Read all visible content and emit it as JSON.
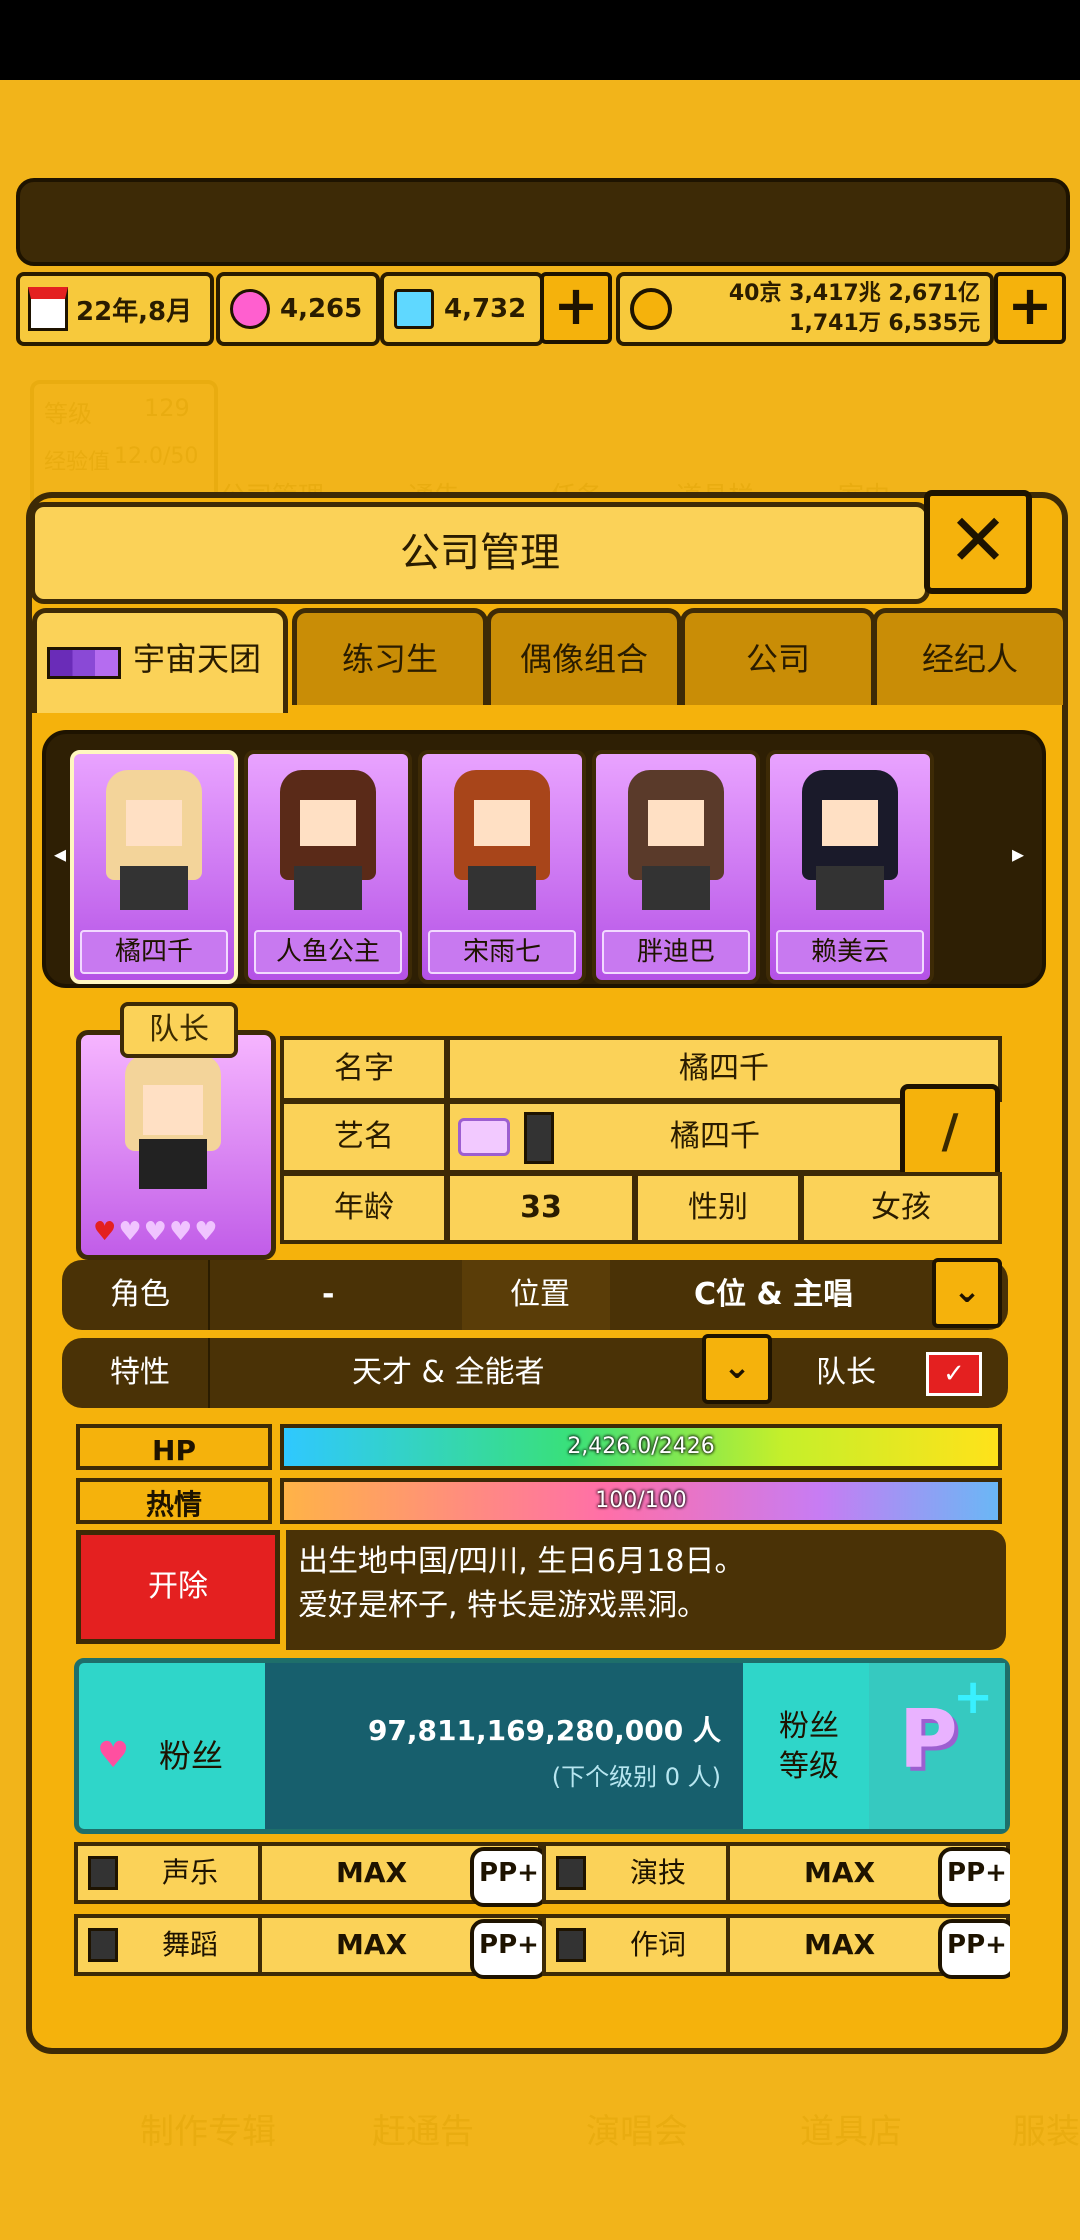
{
  "resources": {
    "date": "22年,8月",
    "gems_pink": "4,265",
    "gems_blue": "4,732",
    "money_line1": "40京 3,417兆 2,671亿",
    "money_line2": "1,741万 6,535元"
  },
  "background_menu": {
    "level_label": "等级",
    "level_value": "129",
    "exp_label": "经验值",
    "exp_value": "12.0/50",
    "top_items": [
      "公司管理",
      "通告",
      "任务",
      "道具栏",
      "室内"
    ],
    "bottom_items": [
      "制作专辑",
      "赶通告",
      "演唱会",
      "道具店",
      "服装"
    ]
  },
  "dialog": {
    "title": "公司管理",
    "close_icon": "close-x-icon",
    "tabs": [
      "宇宙天团",
      "练习生",
      "偶像组合",
      "公司",
      "经纪人"
    ],
    "active_tab": 0
  },
  "roster": [
    {
      "name": "橘四千",
      "selected": true
    },
    {
      "name": "人鱼公主",
      "selected": false
    },
    {
      "name": "宋雨七",
      "selected": false
    },
    {
      "name": "胖迪巴",
      "selected": false
    },
    {
      "name": "赖美云",
      "selected": false
    }
  ],
  "profile": {
    "leader_badge": "队长",
    "hearts_filled": 1,
    "hearts_total": 5,
    "name_label": "名字",
    "name_value": "橘四千",
    "stage_label": "艺名",
    "stage_value": "橘四千",
    "age_label": "年龄",
    "age_value": "33",
    "gender_label": "性别",
    "gender_value": "女孩",
    "role_label": "角色",
    "role_value": "-",
    "position_label": "位置",
    "position_value": "C位 & 主唱",
    "trait_label": "特性",
    "trait_value": "天才 & 全能者",
    "leader_label": "队长",
    "leader_checked": true
  },
  "bars": {
    "hp_label": "HP",
    "hp_text": "2,426.0/2426",
    "hp_ratio": 1.0,
    "passion_label": "热情",
    "passion_text": "100/100",
    "passion_ratio": 1.0
  },
  "fire_button": "开除",
  "bio": {
    "line1": "出生地中国/四川, 生日6月18日。",
    "line2": "爱好是杯子, 特长是游戏黑洞。"
  },
  "fans": {
    "label": "粉丝",
    "count": "97,811,169,280,000 人",
    "next_level": "(下个级别 0 人)",
    "level_label_1": "粉丝",
    "level_label_2": "等级"
  },
  "stats": [
    {
      "name": "声乐",
      "value": "MAX",
      "pp": "PP+",
      "icon": "microphone-icon"
    },
    {
      "name": "演技",
      "value": "MAX",
      "pp": "PP+",
      "icon": "camera-icon"
    },
    {
      "name": "舞蹈",
      "value": "MAX",
      "pp": "PP+",
      "icon": "boot-icon"
    },
    {
      "name": "作词",
      "value": "MAX",
      "pp": "PP+",
      "icon": "pen-icon"
    }
  ],
  "colors": {
    "panel": "#f5b20c",
    "dark": "#3d2a06",
    "fans_teal": "#2fd6c9",
    "fire_red": "#e42020",
    "card_purple": "#c879f0"
  }
}
